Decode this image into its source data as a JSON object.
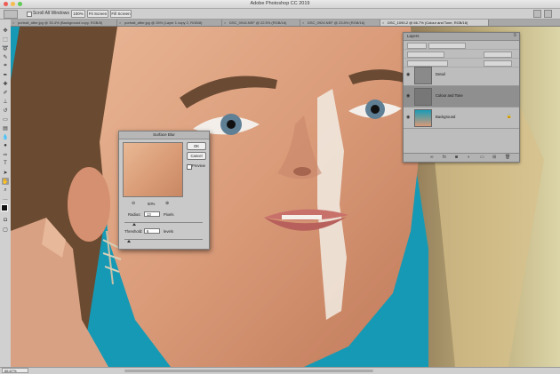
{
  "window": {
    "title": "Adobe Photoshop CC 2019"
  },
  "options_bar": {
    "scroll_all_label": "Scroll All Windows",
    "zoom_btn": "100%",
    "fit_btn": "Fit Screen",
    "fill_btn": "Fill Screen"
  },
  "tabs": [
    "portrait_after.jpg @ 33.4% (Background copy, RGB/8)",
    "portrait_after.jpg @ 25% (Layer 1 copy 2, RGB/8)",
    "DSC_0916.NEF @ 22.5% (RGB/16)",
    "DSC_0924.NEF @ 23.8% (RGB/16)",
    "DSC_1090-2 @ 66.7% (Colour and Tone, RGB/16)"
  ],
  "status": {
    "zoom": "66.67%"
  },
  "layers_panel": {
    "title": "Layers",
    "layers": [
      {
        "name": "Detail",
        "selected": false,
        "thumb": "#8a8a8a"
      },
      {
        "name": "Colour and Tone",
        "selected": true,
        "thumb": "#777777"
      },
      {
        "name": "Background",
        "selected": false,
        "thumb": "#1a9bb5"
      }
    ]
  },
  "dialog": {
    "title": "Surface Blur",
    "ok": "OK",
    "cancel": "Cancel",
    "preview_label": "Preview",
    "zoom_pct": "50%",
    "radius_label": "Radius:",
    "radius_value": "13",
    "radius_unit": "Pixels",
    "threshold_label": "Threshold:",
    "threshold_value": "6",
    "threshold_unit": "levels",
    "radius_slider": 0.13,
    "threshold_slider": 0.06
  },
  "colors": {
    "background_teal": "#1699b4",
    "skin": "#e2a98a",
    "ui_gray": "#cfcfcf"
  }
}
